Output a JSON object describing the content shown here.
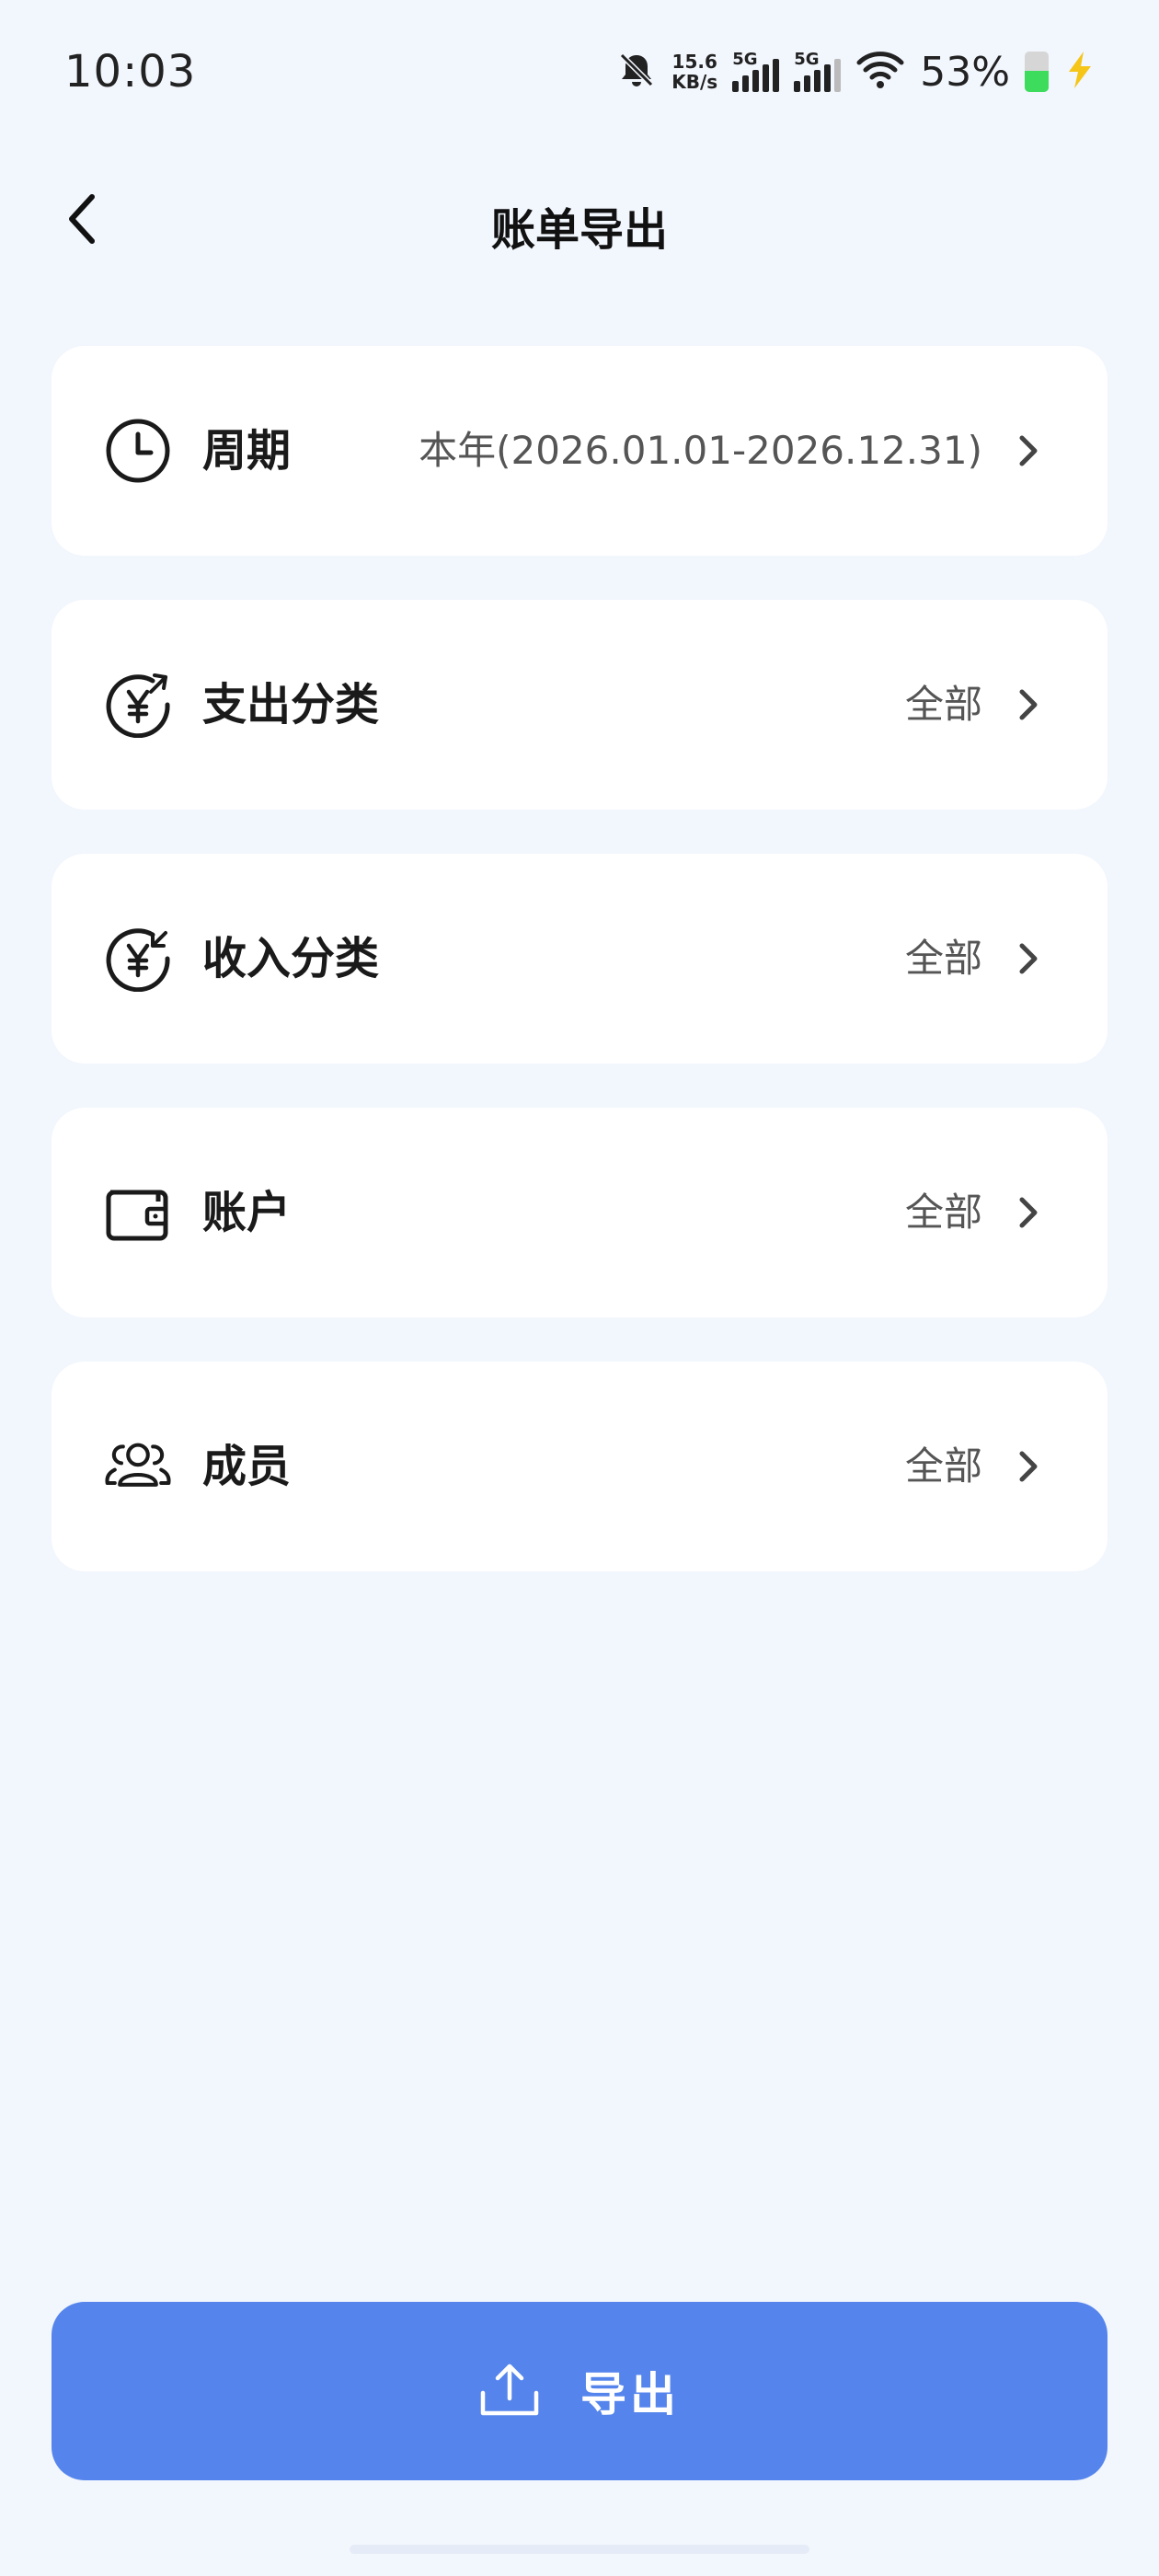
{
  "status_bar": {
    "time": "10:03",
    "net_speed_value": "15.6",
    "net_speed_unit": "KB/s",
    "sim1_label": "5G",
    "sim2_label": "5G",
    "battery_percent": "53%",
    "battery_level": 0.53,
    "icons": [
      "bell-muted-icon",
      "signal-icon",
      "wifi-icon",
      "battery-icon",
      "charging-bolt-icon"
    ]
  },
  "header": {
    "title": "账单导出",
    "back_icon": "chevron-left-icon"
  },
  "rows": [
    {
      "id": "period",
      "icon": "clock-icon",
      "label": "周期",
      "value": "本年(2026.01.01-2026.12.31)"
    },
    {
      "id": "expense-category",
      "icon": "yuan-out-icon",
      "label": "支出分类",
      "value": "全部"
    },
    {
      "id": "income-category",
      "icon": "yuan-in-icon",
      "label": "收入分类",
      "value": "全部"
    },
    {
      "id": "account",
      "icon": "wallet-icon",
      "label": "账户",
      "value": "全部"
    },
    {
      "id": "member",
      "icon": "members-icon",
      "label": "成员",
      "value": "全部"
    }
  ],
  "export_button": {
    "label": "导出",
    "icon": "upload-icon"
  },
  "colors": {
    "background": "#f2f6fd",
    "card": "#ffffff",
    "accent": "#5585ec",
    "battery_fill": "#3ddc5c",
    "charging_bolt": "#f5c518"
  }
}
